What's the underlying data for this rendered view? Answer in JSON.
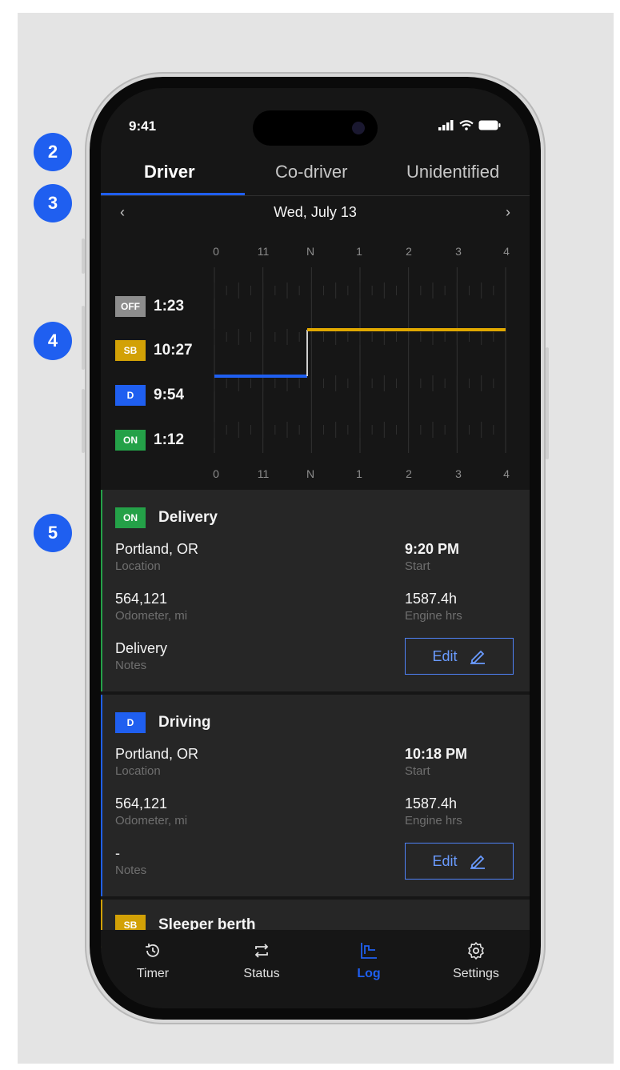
{
  "annotations": [
    "2",
    "3",
    "4",
    "5"
  ],
  "status_bar": {
    "time": "9:41"
  },
  "tabs": [
    {
      "label": "Driver",
      "active": true
    },
    {
      "label": "Co-driver",
      "active": false
    },
    {
      "label": "Unidentified",
      "active": false
    }
  ],
  "date_nav": {
    "prev": "‹",
    "date": "Wed, July 13",
    "next": "›"
  },
  "timeline": {
    "hour_labels": [
      "0",
      "11",
      "N",
      "1",
      "2",
      "3",
      "4"
    ],
    "statuses": [
      {
        "code": "OFF",
        "total": "1:23",
        "color": "#8d8d8d"
      },
      {
        "code": "SB",
        "total": "10:27",
        "color": "#d2a106"
      },
      {
        "code": "D",
        "total": "9:54",
        "color": "#1f5ff0"
      },
      {
        "code": "ON",
        "total": "1:12",
        "color": "#24a148"
      }
    ],
    "segments": [
      {
        "status": "D",
        "from_label": "0",
        "to_label": "N"
      },
      {
        "status": "SB",
        "from_label": "N",
        "to_label": "4"
      }
    ]
  },
  "events": [
    {
      "code": "ON",
      "color": "#24a148",
      "title": "Delivery",
      "location": "Portland, OR",
      "location_label": "Location",
      "start": "9:20 PM",
      "start_label": "Start",
      "odometer": "564,121",
      "odometer_label": "Odometer, mi",
      "engine": "1587.4h",
      "engine_label": "Engine hrs",
      "notes": "Delivery",
      "notes_label": "Notes",
      "edit_label": "Edit"
    },
    {
      "code": "D",
      "color": "#1f5ff0",
      "title": "Driving",
      "location": "Portland, OR",
      "location_label": "Location",
      "start": "10:18 PM",
      "start_label": "Start",
      "odometer": "564,121",
      "odometer_label": "Odometer, mi",
      "engine": "1587.4h",
      "engine_label": "Engine hrs",
      "notes": "-",
      "notes_label": "Notes",
      "edit_label": "Edit"
    },
    {
      "code": "SB",
      "color": "#d2a106",
      "title": "Sleeper berth"
    }
  ],
  "bottom_nav": [
    {
      "label": "Timer",
      "icon": "timer-icon",
      "active": false
    },
    {
      "label": "Status",
      "icon": "status-swap-icon",
      "active": false
    },
    {
      "label": "Log",
      "icon": "log-chart-icon",
      "active": true
    },
    {
      "label": "Settings",
      "icon": "gear-icon",
      "active": false
    }
  ]
}
